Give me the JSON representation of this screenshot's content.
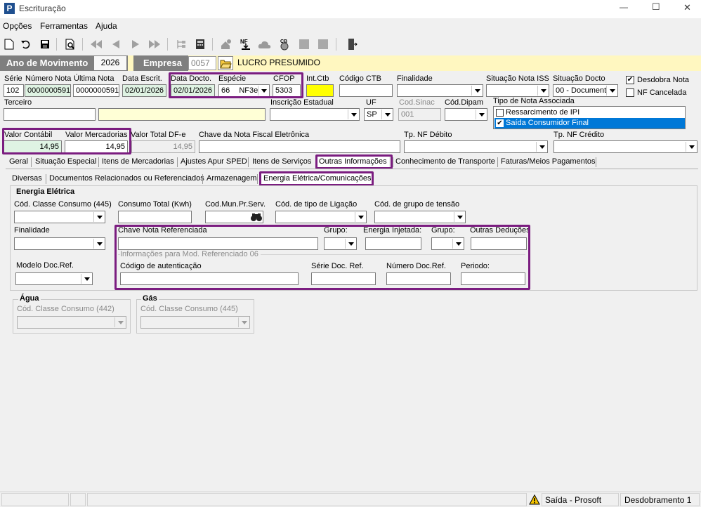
{
  "window": {
    "title": "Escrituração",
    "minimize": "—",
    "maximize": "☐",
    "close": "✕"
  },
  "menu": [
    "Opções",
    "Ferramentas",
    "Ajuda"
  ],
  "header": {
    "ano_label": "Ano de Movimento",
    "ano_value": "2026",
    "empresa_label": "Empresa",
    "empresa_code": "0057",
    "empresa_name": "LUCRO PRESUMIDO"
  },
  "row1": {
    "serie_label": "Série",
    "serie_value": "102",
    "numero_nota_label": "Número Nota",
    "numero_nota_value": "0000000591",
    "ultima_nota_label": "Última Nota",
    "ultima_nota_value": "0000000591",
    "data_escrit_label": "Data Escrit.",
    "data_escrit_value": "02/01/2026",
    "data_docto_label": "Data Docto.",
    "data_docto_value": "02/01/2026",
    "especie_label": "Espécie",
    "especie_code": "66",
    "especie_value": "NF3e",
    "cfop_label": "CFOP",
    "cfop_value": "5303",
    "int_ctb_label": "Int.Ctb",
    "codigo_ctb_label": "Código CTB",
    "finalidade_label": "Finalidade",
    "situacao_iss_label": "Situação Nota ISS",
    "situacao_docto_label": "Situação Docto",
    "situacao_docto_value": "00 - Document",
    "desdobra_label": "Desdobra Nota",
    "nf_cancelada_label": "NF Cancelada"
  },
  "row2": {
    "terceiro_label": "Terceiro",
    "inscricao_label": "Inscrição Estadual",
    "uf_label": "UF",
    "uf_value": "SP",
    "cod_sinac_label": "Cod.Sinac",
    "cod_sinac_value": "001",
    "cod_dipam_label": "Cód.Dipam",
    "tipo_nota_label": "Tipo de Nota Associada",
    "tipo_nota_items": [
      {
        "label": "Ressarcimento de IPI",
        "checked": false
      },
      {
        "label": "Saída Consumidor Final",
        "checked": true
      }
    ]
  },
  "row3": {
    "valor_contabil_label": "Valor Contábil",
    "valor_contabil_value": "14,95",
    "valor_mercadorias_label": "Valor Mercadorias",
    "valor_mercadorias_value": "14,95",
    "valor_total_label": "Valor Total DF-e",
    "valor_total_value": "14,95",
    "chave_label": "Chave da Nota Fiscal Eletrônica",
    "tp_debito_label": "Tp. NF Débito",
    "tp_credito_label": "Tp. NF Crédito"
  },
  "tabs": [
    "Geral",
    "Situação Especial",
    "Itens de Mercadorias",
    "Ajustes Apur SPED",
    "Itens de Serviços",
    "Outras Informações",
    "Conhecimento de Transporte",
    "Faturas/Meios Pagamentos"
  ],
  "subtabs": [
    "Diversas",
    "Documentos Relacionados ou Referenciados",
    "Armazenagem",
    "Energia Elétrica/Comunicações"
  ],
  "energia": {
    "group_title": "Energia Elétrica",
    "classe_consumo_label": "Cód. Classe Consumo (445)",
    "consumo_total_label": "Consumo Total (Kwh)",
    "cod_mun_label": "Cod.Mun.Pr.Serv.",
    "tipo_ligacao_label": "Cód. de tipo de Ligação",
    "grupo_tensao_label": "Cód. de grupo de tensão",
    "finalidade_label": "Finalidade",
    "modelo_doc_label": "Modelo Doc.Ref.",
    "chave_ref_label": "Chave Nota Referenciada",
    "grupo1_label": "Grupo:",
    "energia_injetada_label": "Energia Injetada:",
    "grupo2_label": "Grupo:",
    "outras_deducoes_label": "Outras Deduções",
    "info_mod_label": "Informações para Mod. Referenciado 06",
    "codigo_autenticacao_label": "Código de autenticação",
    "serie_doc_label": "Série Doc. Ref.",
    "numero_doc_label": "Número Doc.Ref.",
    "periodo_label": "Periodo:"
  },
  "agua": {
    "title": "Água",
    "classe_label": "Cód. Classe Consumo (442)"
  },
  "gas": {
    "title": "Gás",
    "classe_label": "Cód. Classe Consumo (445)"
  },
  "status": {
    "saida": "Saída - Prosoft",
    "desdobramento": "Desdobramento 1"
  },
  "colors": {
    "highlight": "#7b1d80",
    "header_bar": "#7f7f7f",
    "yellow_bg": "#ffffd6",
    "green_bg": "#dff3e3",
    "selection": "#0078d7"
  }
}
